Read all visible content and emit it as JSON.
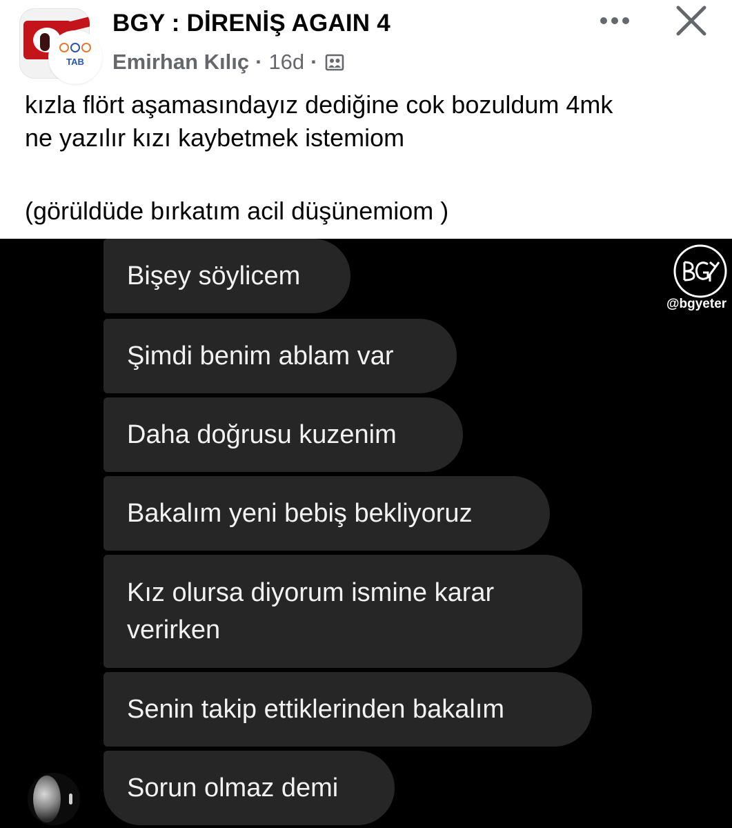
{
  "post": {
    "group_name": "BGY : DİRENİŞ AGAIN 4",
    "author": "Emirhan Kılıç",
    "time": "16d",
    "separator": "·",
    "user_avatar_text": "TAB",
    "body_line1": "kızla flört aşamasındayız dediğine cok bozuldum 4mk",
    "body_line2": "ne yazılır kızı kaybetmek istemiom",
    "body_line3": "(görüldüde bırkatım acil düşünemiom )",
    "icons": {
      "more": "more-options-icon",
      "close": "close-icon",
      "privacy": "group-members-icon"
    }
  },
  "chat": {
    "messages": [
      "Bişey söylicem",
      "Şimdi benim ablam var",
      "Daha doğrusu kuzenim",
      "Bakalım yeni bebiş bekliyoruz",
      "Kız olursa diyorum ismine karar verirken",
      "Senin takip ettiklerinden bakalım",
      "Sorun olmaz demi"
    ],
    "bubble_color": "#262626",
    "background": "#000000"
  },
  "watermark": {
    "logo_text": "BGY",
    "handle": "@bgyeter"
  }
}
